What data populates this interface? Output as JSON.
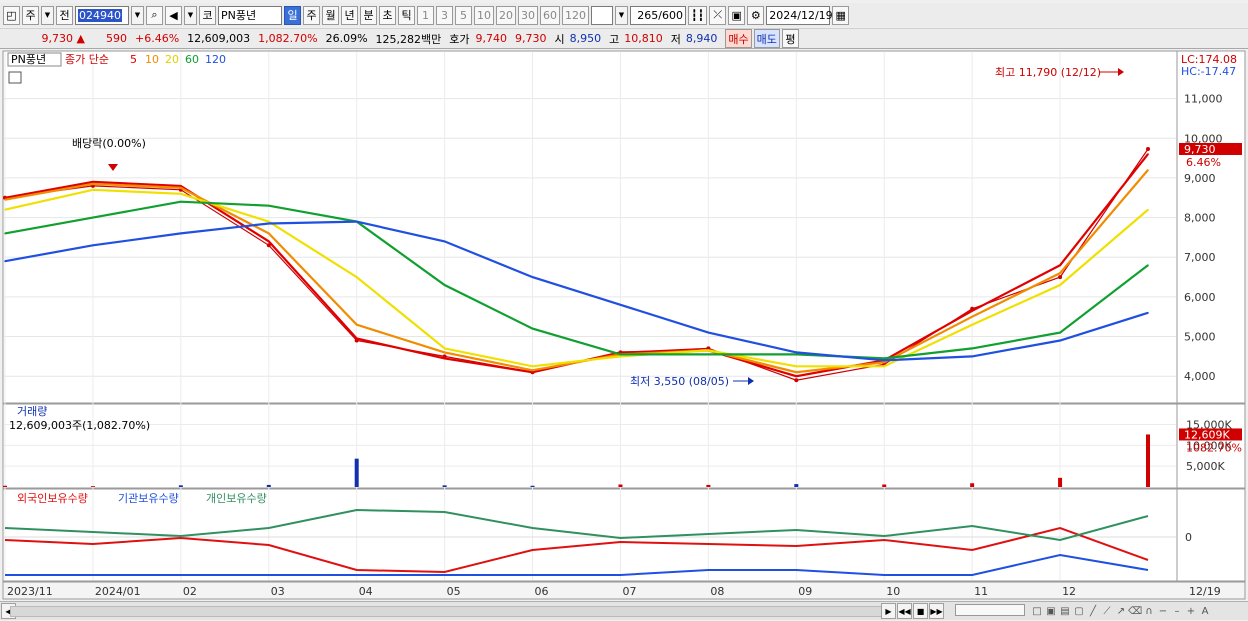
{
  "toolbar": {
    "type1": "주",
    "type2": "전",
    "code": "024940",
    "market": "코",
    "stock_name": "PN풍년",
    "periods": [
      "일",
      "주",
      "월",
      "년",
      "분",
      "초",
      "틱"
    ],
    "active_period": "일",
    "ma_buttons": [
      "1",
      "3",
      "5",
      "10",
      "20",
      "30",
      "60",
      "120"
    ],
    "count_value": "265",
    "count_total": "/600",
    "date": "2024/12/19"
  },
  "quote": {
    "price": "9,730",
    "change_arrow": "▲",
    "change": "590",
    "change_pct": "+6.46%",
    "volume": "12,609,003",
    "volume_pct": "1,082.70%",
    "turnover": "26.09%",
    "amount": "125,282백만",
    "hoga_label": "호가",
    "ask": "9,740",
    "bid": "9,730",
    "open_label": "시",
    "open": "8,950",
    "high_label": "고",
    "high": "10,810",
    "low_label": "저",
    "low": "8,940",
    "buy_label": "매수",
    "sell_label": "매도",
    "eval_label": "평"
  },
  "price_panel": {
    "legend_name": "PN풍년",
    "legend_type": "종가 단순",
    "ma_periods": [
      "5",
      "10",
      "20",
      "60",
      "120"
    ],
    "ma_colors": [
      "#e00000",
      "#f08c00",
      "#f0e000",
      "#10a030",
      "#2050e0"
    ],
    "lc": "LC:174.08",
    "hc": "HC:-17.47",
    "y_ticks": [
      "11,000",
      "10,000",
      "9,000",
      "8,000",
      "7,000",
      "6,000",
      "5,000",
      "4,000"
    ],
    "current_price": "9,730",
    "current_pct": "6.46%",
    "high_note": "최고 11,790 (12/12)",
    "low_note": "최저 3,550 (08/05)",
    "div_note": "배당락(0.00%)"
  },
  "volume_panel": {
    "title": "거래량",
    "value": "12,609,003주(1,082.70%)",
    "y_ticks": [
      "15,000K",
      "10,000K",
      "5,000K"
    ],
    "current": "12,609K",
    "current_pct": "1082.70%"
  },
  "holding_panel": {
    "series": [
      "외국인보유수량",
      "기관보유수량",
      "개인보유수량"
    ],
    "colors": [
      "#e01010",
      "#2050e0",
      "#309060"
    ],
    "zero": "0"
  },
  "x_labels": [
    "2023/11",
    "2024/01",
    "02",
    "03",
    "04",
    "05",
    "06",
    "07",
    "08",
    "09",
    "10",
    "11",
    "12",
    "12/19"
  ],
  "chart_data": {
    "type": "line",
    "x": [
      "2023-11",
      "2023-12",
      "2024-01",
      "2024-02",
      "2024-03",
      "2024-04",
      "2024-05",
      "2024-06",
      "2024-07",
      "2024-08",
      "2024-09",
      "2024-10",
      "2024-11",
      "2024-12"
    ],
    "series": [
      {
        "name": "종가",
        "values": [
          8500,
          8800,
          8700,
          7300,
          4900,
          4500,
          4100,
          4600,
          4700,
          3900,
          4300,
          5700,
          6500,
          9730
        ]
      },
      {
        "name": "5",
        "values": [
          8500,
          8900,
          8800,
          7400,
          4950,
          4450,
          4100,
          4600,
          4650,
          4000,
          4400,
          5650,
          6800,
          9600
        ]
      },
      {
        "name": "10",
        "values": [
          8450,
          8850,
          8750,
          7600,
          5300,
          4600,
          4150,
          4550,
          4650,
          4100,
          4350,
          5500,
          6600,
          9200
        ]
      },
      {
        "name": "20",
        "values": [
          8200,
          8700,
          8600,
          7900,
          6500,
          4700,
          4250,
          4500,
          4650,
          4250,
          4250,
          5300,
          6300,
          8200
        ]
      },
      {
        "name": "60",
        "values": [
          7600,
          8000,
          8400,
          8300,
          7900,
          6300,
          5200,
          4550,
          4550,
          4550,
          4450,
          4700,
          5100,
          6800
        ]
      },
      {
        "name": "120",
        "values": [
          6900,
          7300,
          7600,
          7850,
          7900,
          7400,
          6500,
          5800,
          5100,
          4600,
          4400,
          4500,
          4900,
          5600
        ]
      }
    ],
    "ylim": [
      3400,
      12100
    ],
    "volume_k": [
      300,
      200,
      400,
      500,
      6800,
      400,
      300,
      600,
      500,
      700,
      600,
      900,
      2200,
      12609
    ],
    "volume_ylim": [
      0,
      18000
    ]
  }
}
